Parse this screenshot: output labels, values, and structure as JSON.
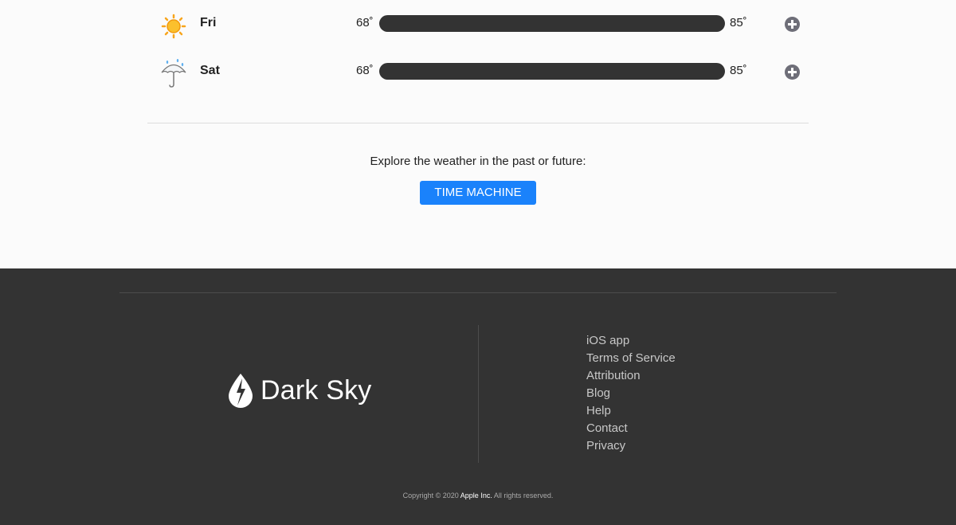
{
  "forecast": {
    "days": [
      {
        "name": "Fri",
        "icon": "sun-icon",
        "low": "68˚",
        "high": "85˚"
      },
      {
        "name": "Sat",
        "icon": "umbrella-icon",
        "low": "68˚",
        "high": "85˚"
      }
    ]
  },
  "time_machine": {
    "prompt": "Explore the weather in the past or future:",
    "button_label": "TIME MACHINE"
  },
  "footer": {
    "brand": "Dark Sky",
    "links": [
      "iOS app",
      "Terms of Service",
      "Attribution",
      "Blog",
      "Help",
      "Contact",
      "Privacy"
    ],
    "copyright_prefix": "Copyright © 2020",
    "copyright_company": "Apple Inc.",
    "copyright_suffix": "All rights reserved."
  },
  "colors": {
    "accent": "#1a82fb",
    "footer_bg": "#333333",
    "bar": "#333333",
    "sun": "#f7a51d"
  }
}
